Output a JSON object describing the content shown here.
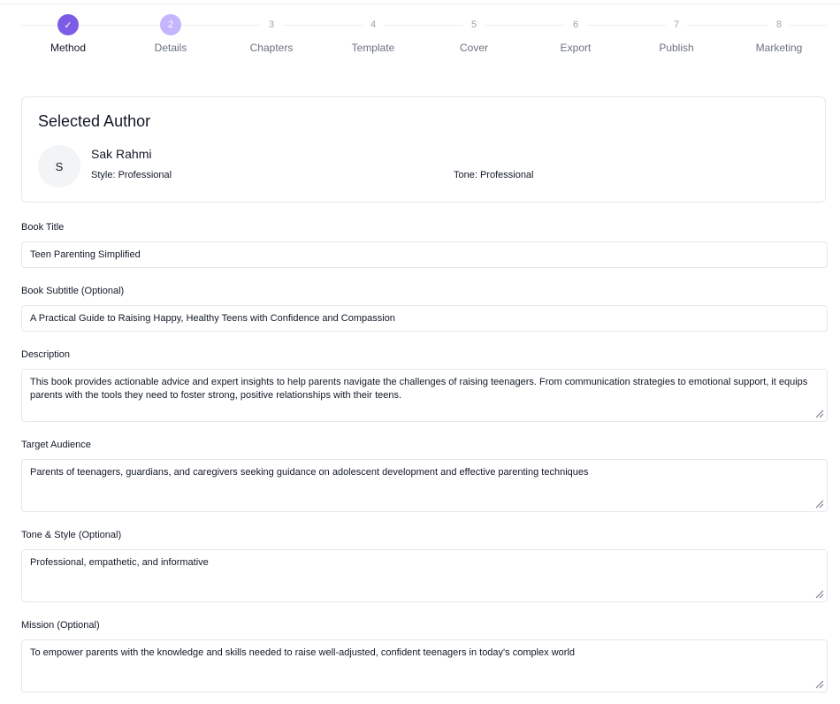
{
  "stepper": {
    "steps": [
      {
        "marker": "✓",
        "label": "Method",
        "state": "done"
      },
      {
        "marker": "2",
        "label": "Details",
        "state": "current"
      },
      {
        "marker": "3",
        "label": "Chapters",
        "state": "upcoming"
      },
      {
        "marker": "4",
        "label": "Template",
        "state": "upcoming"
      },
      {
        "marker": "5",
        "label": "Cover",
        "state": "upcoming"
      },
      {
        "marker": "6",
        "label": "Export",
        "state": "upcoming"
      },
      {
        "marker": "7",
        "label": "Publish",
        "state": "upcoming"
      },
      {
        "marker": "8",
        "label": "Marketing",
        "state": "upcoming"
      }
    ],
    "colors": {
      "done": "#7c5ce6",
      "current": "#c4b5fd"
    }
  },
  "author": {
    "heading": "Selected Author",
    "initial": "S",
    "name": "Sak Rahmi",
    "style": "Style: Professional",
    "tone": "Tone: Professional"
  },
  "form": {
    "title": {
      "label": "Book Title",
      "value": "Teen Parenting Simplified"
    },
    "subtitle": {
      "label": "Book Subtitle (Optional)",
      "value": "A Practical Guide to Raising Happy, Healthy Teens with Confidence and Compassion"
    },
    "description": {
      "label": "Description",
      "value": "This book provides actionable advice and expert insights to help parents navigate the challenges of raising teenagers. From communication strategies to emotional support, it equips parents with the tools they need to foster strong, positive relationships with their teens."
    },
    "audience": {
      "label": "Target Audience",
      "value": "Parents of teenagers, guardians, and caregivers seeking guidance on adolescent development and effective parenting techniques"
    },
    "tone_style": {
      "label": "Tone & Style (Optional)",
      "value": "Professional, empathetic, and informative"
    },
    "mission": {
      "label": "Mission (Optional)",
      "value": "To empower parents with the knowledge and skills needed to raise well-adjusted, confident teenagers in today's complex world"
    }
  }
}
